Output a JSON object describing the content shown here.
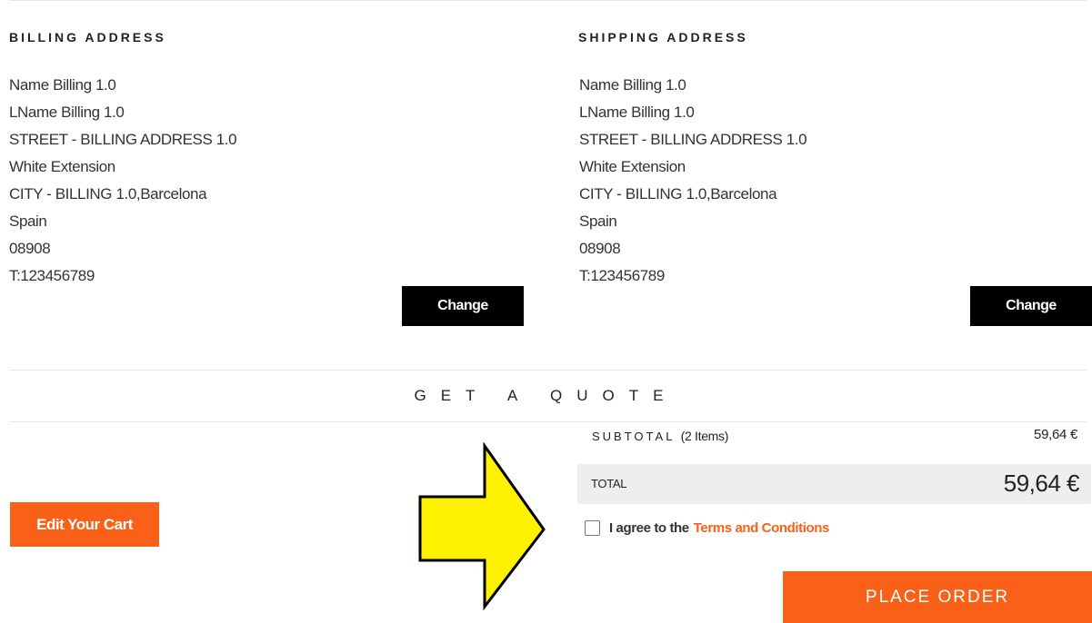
{
  "billing": {
    "heading": "BILLING ADDRESS",
    "lines": [
      "Name Billing 1.0",
      "LName Billing 1.0",
      "STREET - BILLING ADDRESS 1.0",
      "White Extension",
      "CITY - BILLING 1.0,Barcelona",
      "Spain",
      "08908",
      "T:123456789"
    ],
    "change_label": "Change"
  },
  "shipping": {
    "heading": "SHIPPING ADDRESS",
    "lines": [
      "Name Billing 1.0",
      "LName Billing 1.0",
      "STREET - BILLING ADDRESS 1.0",
      "White Extension",
      "CITY - BILLING 1.0,Barcelona",
      "Spain",
      "08908",
      "T:123456789"
    ],
    "change_label": "Change"
  },
  "quote": {
    "title": "GET A QUOTE"
  },
  "cart": {
    "edit_label": "Edit Your Cart"
  },
  "summary": {
    "subtotal_label": "SUBTOTAL",
    "subtotal_items": "(2 Items)",
    "subtotal_value": "59,64 €",
    "total_label": "TOTAL",
    "total_value": "59,64 €"
  },
  "agreement": {
    "text": "I agree to the",
    "link": "Terms and Conditions"
  },
  "order": {
    "place_label": "PLACE ORDER"
  },
  "colors": {
    "accent": "#fb6018",
    "arrow_fill": "#fff200",
    "button_dark": "#000000"
  },
  "icons": {
    "arrow": "arrow-right-icon"
  }
}
